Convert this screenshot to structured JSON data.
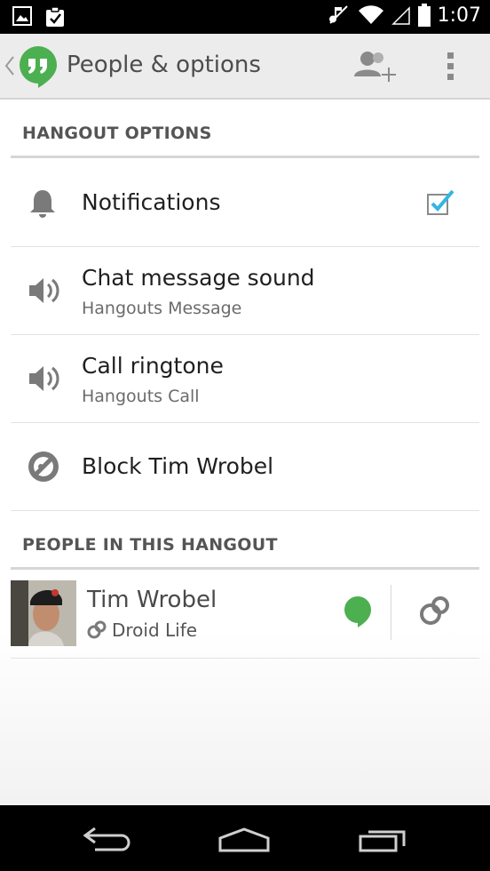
{
  "status_bar": {
    "time": "1:07",
    "icons": [
      "picture-icon",
      "clipboard-check-icon",
      "muted-icon",
      "wifi-icon",
      "signal-icon",
      "battery-icon"
    ]
  },
  "action_bar": {
    "title": "People & options",
    "icons": [
      "up-caret-icon",
      "hangouts-logo-icon",
      "add-person-icon",
      "overflow-menu-icon"
    ]
  },
  "hangout_options": {
    "header": "HANGOUT OPTIONS",
    "items": [
      {
        "title": "Notifications",
        "icon": "bell-icon",
        "checked": true
      },
      {
        "title": "Chat message sound",
        "subtitle": "Hangouts Message",
        "icon": "speaker-icon"
      },
      {
        "title": "Call ringtone",
        "subtitle": "Hangouts Call",
        "icon": "speaker-icon"
      },
      {
        "title": "Block Tim Wrobel",
        "icon": "block-icon"
      }
    ]
  },
  "people": {
    "header": "PEOPLE IN THIS HANGOUT",
    "members": [
      {
        "name": "Tim Wrobel",
        "subtitle": "Droid Life",
        "presence_color": "#4caf50",
        "icon": "link-icon"
      }
    ]
  },
  "colors": {
    "accent": "#33b5e5",
    "presence": "#4caf50",
    "logo_green": "#4caf50"
  },
  "nav_bar": {
    "icons": [
      "back-icon",
      "home-icon",
      "recents-icon"
    ]
  }
}
